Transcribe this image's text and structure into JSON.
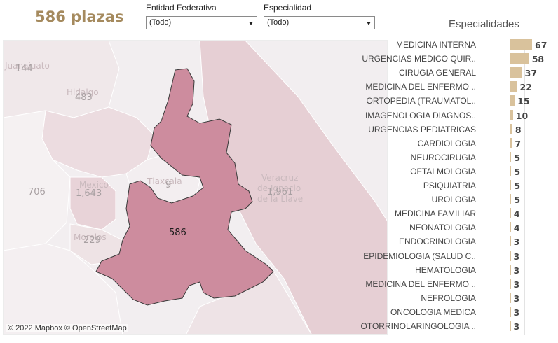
{
  "header": {
    "title": "586 plazas"
  },
  "filters": [
    {
      "label": "Entidad Federativa",
      "value": "(Todo)"
    },
    {
      "label": "Especialidad",
      "value": "(Todo)"
    }
  ],
  "map": {
    "attribution": "© 2022 Mapbox  © OpenStreetMap",
    "selected_value": "586",
    "region_values": [
      {
        "label": "144"
      },
      {
        "label": "483"
      },
      {
        "label": "706"
      },
      {
        "label": "1,643"
      },
      {
        "label": "9"
      },
      {
        "label": "229"
      },
      {
        "label": "1,961"
      }
    ],
    "place_names": [
      "Juanajuato",
      "Hidalgo",
      "Tlaxcala",
      "Mexico",
      "Morelos",
      "Veracruz",
      "de Ignacio",
      "de la Llave"
    ],
    "colors": {
      "selected": "#cd8c9e",
      "dark": "#e6cfd4",
      "light": "#f3eaec",
      "bg": "#f3eff0"
    }
  },
  "especialidades": {
    "title": "Especialidades",
    "bar_color": "#d9c29c",
    "max": 67,
    "items": [
      {
        "label": "MEDICINA INTERNA",
        "value": 67
      },
      {
        "label": "URGENCIAS MEDICO QUIR..",
        "value": 58
      },
      {
        "label": "CIRUGIA GENERAL",
        "value": 37
      },
      {
        "label": "MEDICINA DEL ENFERMO ..",
        "value": 22
      },
      {
        "label": "ORTOPEDIA (TRAUMATOL..",
        "value": 15
      },
      {
        "label": "IMAGENOLOGIA DIAGNOS..",
        "value": 10
      },
      {
        "label": "URGENCIAS PEDIATRICAS",
        "value": 8
      },
      {
        "label": "CARDIOLOGIA",
        "value": 7
      },
      {
        "label": "NEUROCIRUGIA",
        "value": 5
      },
      {
        "label": "OFTALMOLOGIA",
        "value": 5
      },
      {
        "label": "PSIQUIATRIA",
        "value": 5
      },
      {
        "label": "UROLOGIA",
        "value": 5
      },
      {
        "label": "MEDICINA FAMILIAR",
        "value": 4
      },
      {
        "label": "NEONATOLOGIA",
        "value": 4
      },
      {
        "label": "ENDOCRINOLOGIA",
        "value": 3
      },
      {
        "label": "EPIDEMIOLOGIA (SALUD C..",
        "value": 3
      },
      {
        "label": "HEMATOLOGIA",
        "value": 3
      },
      {
        "label": "MEDICINA DEL ENFERMO ..",
        "value": 3
      },
      {
        "label": "NEFROLOGIA",
        "value": 3
      },
      {
        "label": "ONCOLOGIA MEDICA",
        "value": 3
      },
      {
        "label": "OTORRINOLARINGOLOGIA ..",
        "value": 3
      }
    ]
  }
}
